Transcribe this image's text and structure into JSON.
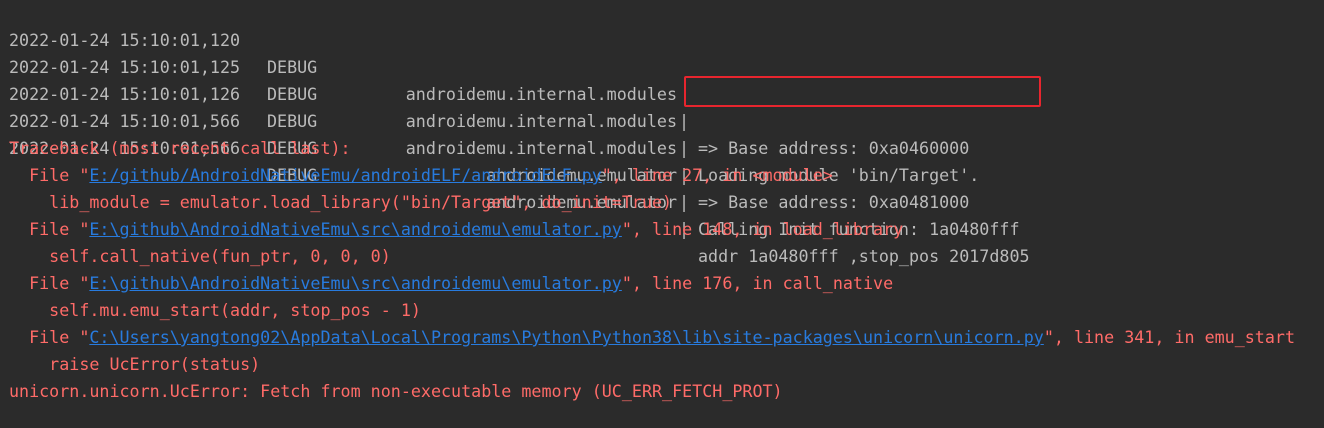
{
  "log_lines": [
    {
      "timestamp": "2022-01-24 15:10:01,120",
      "level": "DEBUG",
      "module": "androidemu.internal.modules",
      "separator": "|",
      "message": "=> Base address: 0xa0460000"
    },
    {
      "timestamp": "2022-01-24 15:10:01,125",
      "level": "DEBUG",
      "module": "androidemu.internal.modules",
      "separator": "|",
      "message": "Loading module 'bin/Target'."
    },
    {
      "timestamp": "2022-01-24 15:10:01,126",
      "level": "DEBUG",
      "module": "androidemu.internal.modules",
      "separator": "|",
      "message": "=> Base address: 0xa0481000"
    },
    {
      "timestamp": "2022-01-24 15:10:01,566",
      "level": "DEBUG",
      "module": "androidemu.emulator",
      "separator": "|",
      "message": "Calling Init function: 1a0480fff"
    },
    {
      "timestamp": "2022-01-24 15:10:01,566",
      "level": "DEBUG",
      "module": "androidemu.emulator",
      "separator": "|",
      "message": "addr 1a0480fff ,stop_pos 2017d805"
    }
  ],
  "traceback": {
    "header": "Traceback (most recent call last):",
    "frames": [
      {
        "prefix": "  File \"",
        "path": "E:/github/AndroidNativeEmu/androidELF/androidELF.py",
        "suffix": "\", line 27, in <module>",
        "code": "    lib_module = emulator.load_library(\"bin/Target\", do_init=True)"
      },
      {
        "prefix": "  File \"",
        "path": "E:\\github\\AndroidNativeEmu\\src\\androidemu\\emulator.py",
        "suffix": "\", line 148, in load_library",
        "code": "    self.call_native(fun_ptr, 0, 0, 0)"
      },
      {
        "prefix": "  File \"",
        "path": "E:\\github\\AndroidNativeEmu\\src\\androidemu\\emulator.py",
        "suffix": "\", line 176, in call_native",
        "code": "    self.mu.emu_start(addr, stop_pos - 1)"
      },
      {
        "prefix": "  File \"",
        "path": "C:\\Users\\yangtong02\\AppData\\Local\\Programs\\Python\\Python38\\lib\\site-packages\\unicorn\\unicorn.py",
        "suffix": "\", line 341, in emu_start",
        "code": "    raise UcError(status)"
      }
    ],
    "error": "unicorn.unicorn.UcError: Fetch from non-executable memory (UC_ERR_FETCH_PROT)"
  },
  "colors": {
    "background": "#2b2b2b",
    "log_text": "#bbbbbb",
    "error_text": "#ff6b68",
    "link": "#287bde",
    "highlight_box": "#e8252e"
  }
}
